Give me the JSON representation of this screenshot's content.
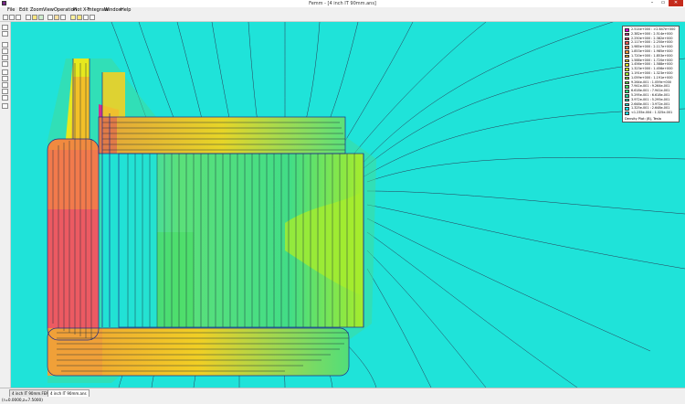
{
  "window": {
    "title": "Femm - [4 inch IT 90mm.ans]",
    "controls": {
      "minimize": "–",
      "maximize": "▭",
      "close": "✕"
    }
  },
  "menu": [
    "File",
    "Edit",
    "Zoom",
    "View",
    "Operation",
    "Plot X-Y",
    "Integrate",
    "Window",
    "Help"
  ],
  "legend": {
    "colors": [
      "#e000e0",
      "#d03090",
      "#e0406a",
      "#e85a56",
      "#f07a48",
      "#f59a3a",
      "#f8b82e",
      "#f2d024",
      "#e6e81e",
      "#c8ee22",
      "#a6ec2c",
      "#86e838",
      "#64e24a",
      "#48dc62",
      "#34d67c",
      "#28d298",
      "#1fd8b4",
      "#1fe3d9",
      "#1de7f0",
      "#23eeff"
    ],
    "rows": [
      "2.514e+000 : >2.647e+000",
      "2.382e+000 : 2.514e+000",
      "2.250e+000 : 2.382e+000",
      "2.117e+000 : 2.250e+000",
      "1.985e+000 : 2.117e+000",
      "1.853e+000 : 1.985e+000",
      "1.720e+000 : 1.853e+000",
      "1.588e+000 : 1.720e+000",
      "1.456e+000 : 1.588e+000",
      "1.323e+000 : 1.456e+000",
      "1.191e+000 : 1.323e+000",
      "1.059e+000 : 1.191e+000",
      "9.264e-001 : 1.059e+000",
      "7.941e-001 : 9.264e-001",
      "6.618e-001 : 7.941e-001",
      "5.295e-001 : 6.618e-001",
      "3.972e-001 : 5.295e-001",
      "2.648e-001 : 3.972e-001",
      "1.325e-001 : 2.648e-001",
      "<1.235e-004 : 1.325e-001"
    ],
    "caption": "Density Plot: |B|, Tesla"
  },
  "tabs": [
    "4 inch IT 90mm.FEM",
    "4 inch IT 90mm.ans"
  ],
  "status": {
    "coords": "(r=0.0000,z=7.5000)"
  },
  "colors": {
    "background_field": "#1fe3d9",
    "magnet": "#3fdc8a",
    "pole_hot": "#ec5a62",
    "window_close": "#c42b1c"
  },
  "icons": {
    "toolbar": [
      "new-file-icon",
      "open-file-icon",
      "save-icon",
      "zoom-in-icon",
      "zoom-out-icon",
      "contour-plot-icon",
      "density-plot-icon",
      "vector-plot-icon",
      "point-values-icon",
      "line-values-icon",
      "block-integral-icon",
      "area-select-icon",
      "pointer-icon"
    ],
    "sidebar": [
      "zoom-window-icon",
      "zoom-extents-icon",
      "zoom-in-side-icon",
      "zoom-out-side-icon",
      "grid-icon",
      "snap-icon",
      "mesh-icon",
      "arrow-icon",
      "point-mode-icon",
      "contour-mode-icon",
      "area-mode-icon",
      "refresh-icon"
    ]
  }
}
